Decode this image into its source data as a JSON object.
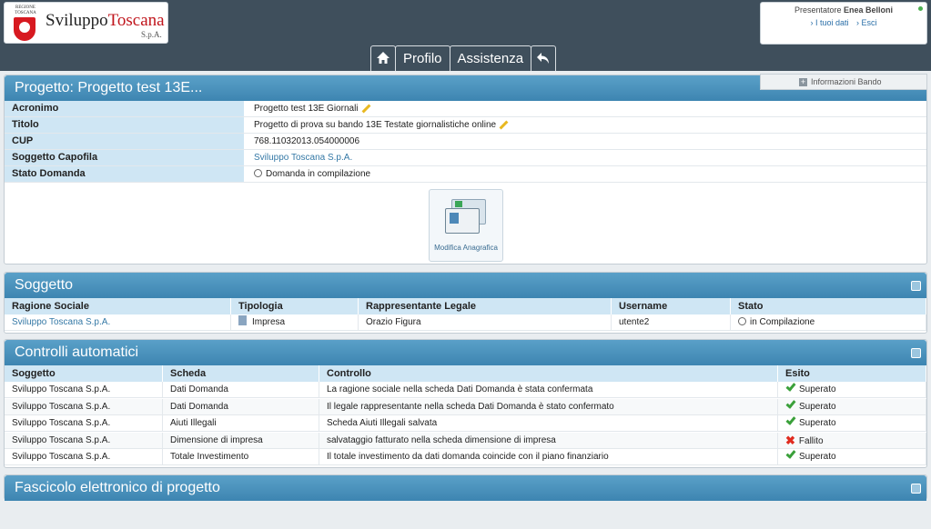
{
  "logo": {
    "region": "REGIONE TOSCANA",
    "name_a": "Sviluppo",
    "name_b": "Toscana",
    "suffix": "S.p.A."
  },
  "user": {
    "role_label": "Presentatore",
    "name": "Enea Belloni",
    "link_my_data": "› I tuoi dati",
    "link_exit": "› Esci"
  },
  "nav": {
    "home_icon": "home-icon",
    "profile": "Profilo",
    "assistance": "Assistenza",
    "back_icon": "back-arrow-icon"
  },
  "info_bando": "Informazioni Bando",
  "project": {
    "title": "Progetto: Progetto test 13E...",
    "rows": [
      {
        "key": "Acronimo",
        "value": "Progetto test 13E Giornali"
      },
      {
        "key": "Titolo",
        "value": "Progetto di prova su bando 13E Testate giornalistiche online"
      },
      {
        "key": "CUP",
        "value": "768.11032013.054000006"
      },
      {
        "key": "Soggetto Capofila",
        "value": "Sviluppo Toscana S.p.A."
      },
      {
        "key": "Stato Domanda",
        "value": "Domanda in compilazione"
      }
    ],
    "edit_card_label": "Modifica Anagrafica"
  },
  "soggetto": {
    "title": "Soggetto",
    "headers": [
      "Ragione Sociale",
      "Tipologia",
      "Rappresentante Legale",
      "Username",
      "Stato"
    ],
    "row": [
      "Sviluppo Toscana S.p.A.",
      "Impresa",
      "Orazio Figura",
      "utente2",
      "in Compilazione"
    ]
  },
  "controlli": {
    "title": "Controlli automatici",
    "headers": [
      "Soggetto",
      "Scheda",
      "Controllo",
      "Esito"
    ],
    "rows": [
      [
        "Sviluppo Toscana S.p.A.",
        "Dati Domanda",
        "La ragione sociale nella scheda Dati Domanda è stata confermata",
        "Superato"
      ],
      [
        "Sviluppo Toscana S.p.A.",
        "Dati Domanda",
        "Il legale rappresentante nella scheda Dati Domanda è stato confermato",
        "Superato"
      ],
      [
        "Sviluppo Toscana S.p.A.",
        "Aiuti Illegali",
        "Scheda Aiuti Illegali salvata",
        "Superato"
      ],
      [
        "Sviluppo Toscana S.p.A.",
        "Dimensione di impresa",
        "salvataggio fatturato nella scheda dimensione di impresa",
        "Fallito"
      ],
      [
        "Sviluppo Toscana S.p.A.",
        "Totale Investimento",
        "Il totale investimento da dati domanda coincide con il piano finanziario",
        "Superato"
      ]
    ]
  },
  "fascicolo": {
    "title": "Fascicolo elettronico di progetto"
  },
  "colors": {
    "topbar": "#3f4f5c",
    "panel_header": "#4a90bd",
    "label_bg": "#cfe6f4",
    "pass": "#3aa03a",
    "fail": "#e02b1f"
  }
}
